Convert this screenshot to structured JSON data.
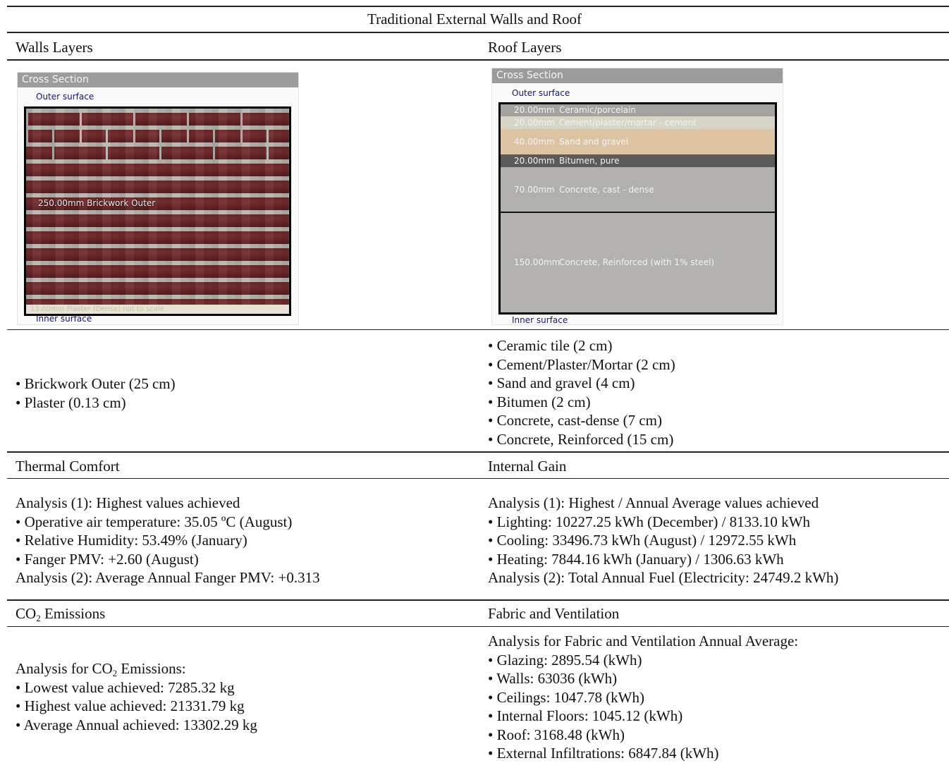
{
  "title": "Traditional External Walls and Roof",
  "walls": {
    "heading": "Walls Layers",
    "panel": {
      "header": "Cross Section",
      "outer": "Outer surface",
      "inner": "Inner surface",
      "brick_label": "250.00mm Brickwork Outer",
      "plaster_label": "13.00mm  Plaster (Dense) not to scale"
    },
    "bullets": [
      "• Brickwork Outer (25 cm)",
      "• Plaster (0.13 cm)"
    ]
  },
  "roof": {
    "heading": "Roof Layers",
    "panel": {
      "header": "Cross Section",
      "outer": "Outer surface",
      "inner": "Inner surface",
      "layers": [
        {
          "mm": "20.00mm",
          "name": "Ceramic/porcelain",
          "color": "#a5a3a0"
        },
        {
          "mm": "20.00mm",
          "name": "Cement/plaster/mortar - cement",
          "color": "#d8d4c6"
        },
        {
          "mm": "40.00mm",
          "name": "Sand and gravel",
          "color": "#dcc4a2"
        },
        {
          "mm": "20.00mm",
          "name": "Bitumen, pure",
          "color": "#5a5a5a"
        },
        {
          "mm": "70.00mm",
          "name": "Concrete, cast - dense",
          "color": "#b1b0ad"
        },
        {
          "mm": "150.00mm",
          "name": "Concrete, Reinforced (with 1% steel)",
          "color": "#b3b2ae"
        }
      ]
    },
    "bullets": [
      "• Ceramic tile (2 cm)",
      "• Cement/Plaster/Mortar (2 cm)",
      "• Sand and gravel (4 cm)",
      "• Bitumen (2 cm)",
      "• Concrete, cast-dense (7 cm)",
      "• Concrete, Reinforced (15 cm)"
    ]
  },
  "thermal": {
    "heading": "Thermal Comfort",
    "lines": [
      "Analysis (1):  Highest values achieved",
      "• Operative air temperature: 35.05 ºC (August)",
      "• Relative Humidity: 53.49% (January)",
      "• Fanger PMV: +2.60 (August)",
      "Analysis (2):  Average Annual Fanger PMV: +0.313"
    ]
  },
  "internal_gain": {
    "heading": "Internal Gain",
    "lines": [
      "Analysis (1): Highest / Annual Average values achieved",
      "• Lighting: 10227.25 kWh (December) / 8133.10 kWh",
      "• Cooling: 33496.73 kWh (August) / 12972.55 kWh",
      "• Heating: 7844.16 kWh (January) / 1306.63 kWh",
      "Analysis (2): Total Annual Fuel (Electricity: 24749.2 kWh)"
    ]
  },
  "co2": {
    "heading_pre": "CO",
    "heading_sub": "2",
    "heading_post": " Emissions",
    "analysis_pre": "Analysis for CO",
    "analysis_sub": "2",
    "analysis_post": " Emissions:",
    "lines": [
      "• Lowest value achieved: 7285.32 kg",
      "• Highest value achieved: 21331.79 kg",
      "• Average Annual achieved: 13302.29 kg"
    ]
  },
  "fabric": {
    "heading": "Fabric and Ventilation",
    "lines": [
      "Analysis for Fabric and Ventilation Annual Average:",
      "• Glazing: 2895.54 (kWh)",
      "• Walls: 63036 (kWh)",
      "• Ceilings: 1047.78 (kWh)",
      "• Internal Floors: 1045.12 (kWh)",
      "• Roof: 3168.48 (kWh)",
      "• External Infiltrations: 6847.84 (kWh)"
    ]
  }
}
